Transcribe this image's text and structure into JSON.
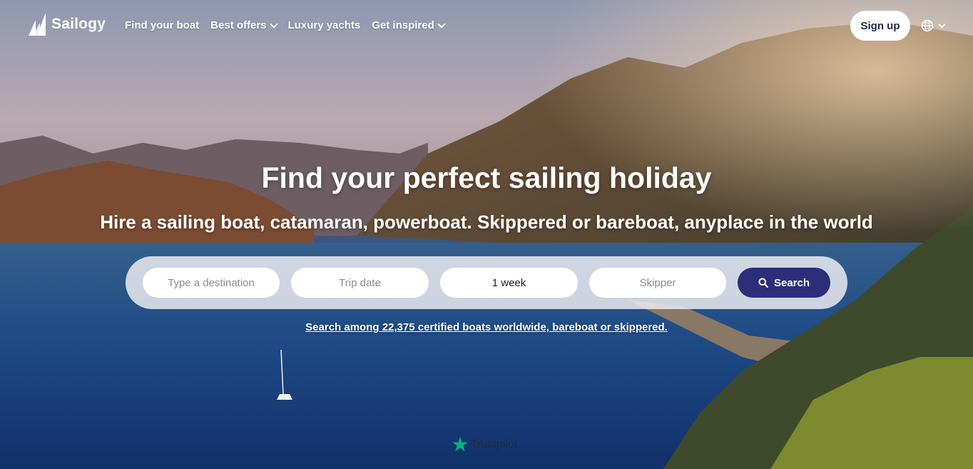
{
  "brand": {
    "name": "Sailogy"
  },
  "nav": {
    "links": [
      {
        "label": "Find your boat",
        "has_dropdown": false
      },
      {
        "label": "Best offers",
        "has_dropdown": true
      },
      {
        "label": "Luxury yachts",
        "has_dropdown": false
      },
      {
        "label": "Get inspired",
        "has_dropdown": true
      }
    ],
    "signup_label": "Sign up",
    "language_icon": "globe-icon"
  },
  "hero": {
    "title": "Find your perfect sailing holiday",
    "subtitle": "Hire a sailing boat, catamaran, powerboat. Skippered or bareboat, anyplace in the world"
  },
  "search": {
    "destination_placeholder": "Type a destination",
    "date_placeholder": "Trip date",
    "duration_value": "1 week",
    "skipper_placeholder": "Skipper",
    "button_label": "Search",
    "button_icon": "search-icon",
    "button_color": "#2c2e7a"
  },
  "boat_count_link": "Search among 22,375 certified boats worldwide, bareboat or skippered.",
  "trustpilot": {
    "label": "Trustpilot",
    "star_color": "#00b67a"
  }
}
